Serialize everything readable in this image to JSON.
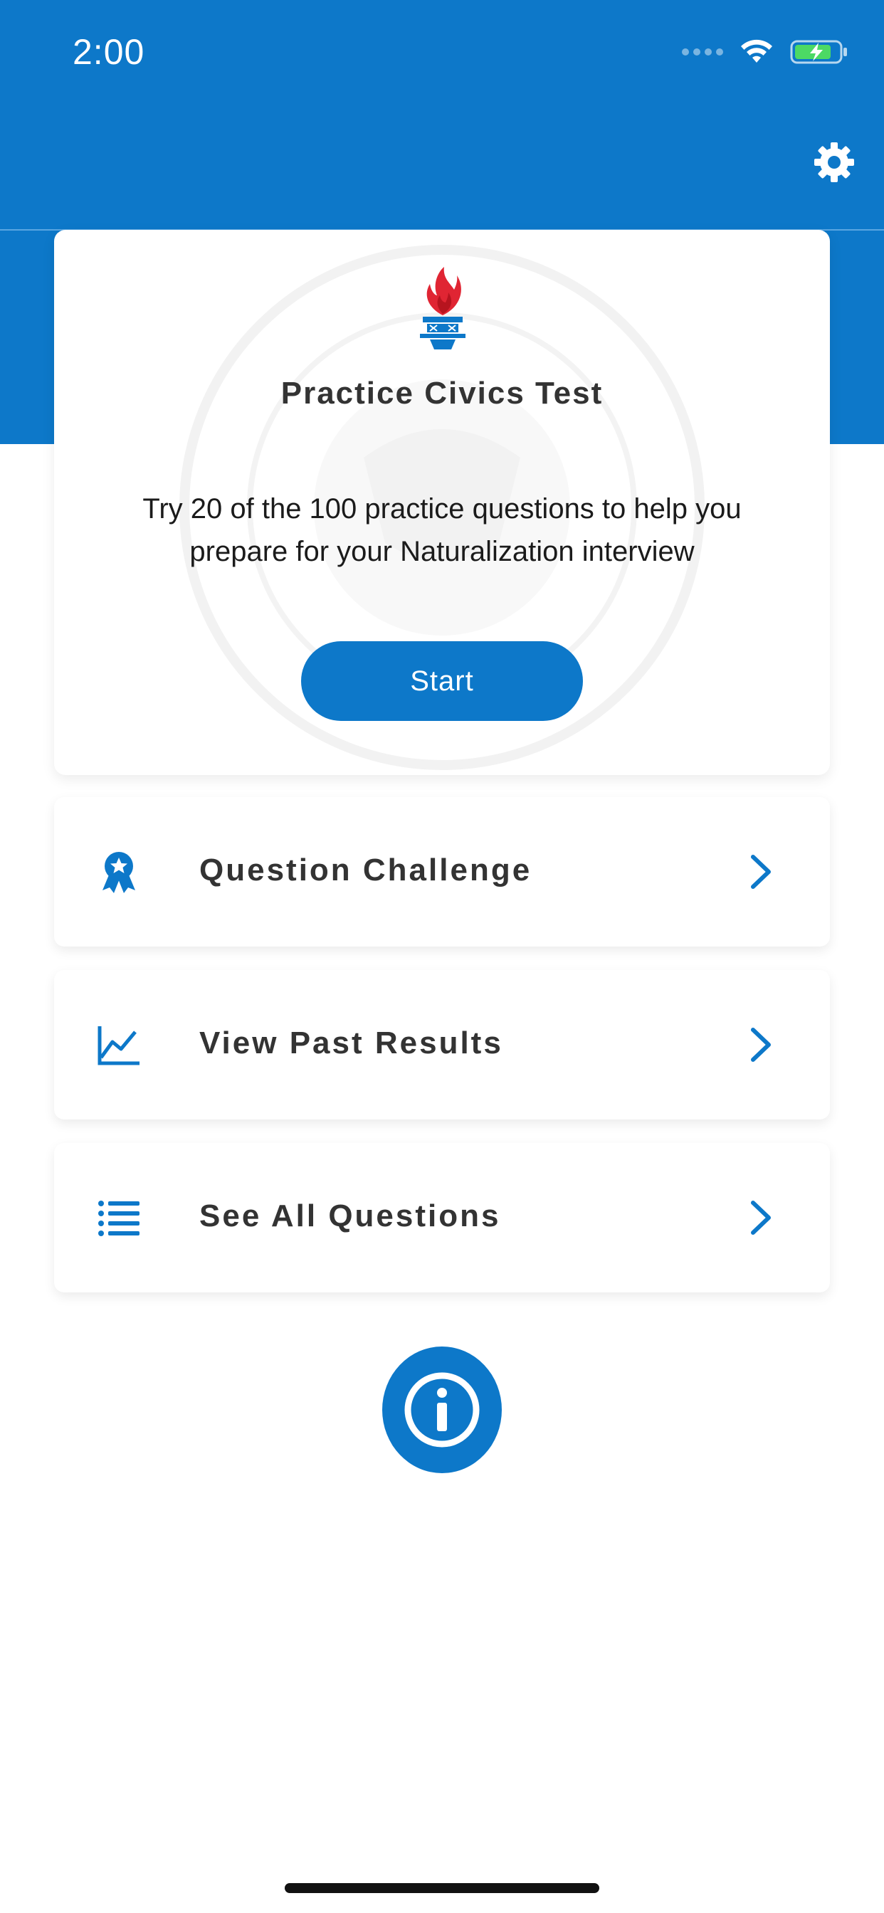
{
  "status_bar": {
    "time": "2:00"
  },
  "header": {
    "settings_icon": "gear-icon",
    "accent_color": "#0d78c9"
  },
  "practice_card": {
    "title": "Practice Civics Test",
    "description": "Try 20 of the 100 practice questions to help you prepare for your Naturalization interview",
    "start_label": "Start",
    "logo_icon": "torch-icon"
  },
  "menu": [
    {
      "label": "Question Challenge",
      "icon": "award-ribbon-icon"
    },
    {
      "label": "View Past Results",
      "icon": "line-chart-icon"
    },
    {
      "label": "See All Questions",
      "icon": "list-icon"
    }
  ],
  "footer": {
    "info_icon": "info-icon"
  }
}
